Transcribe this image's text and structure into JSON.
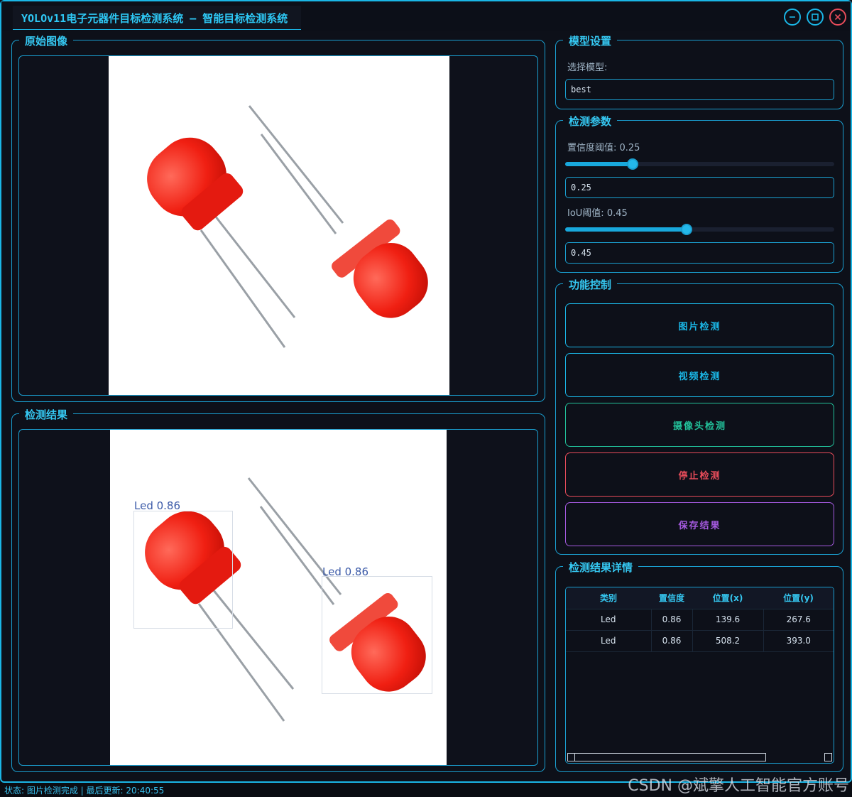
{
  "window": {
    "title": "YOLOv11电子元器件目标检测系统 – 智能目标检测系统",
    "controls": [
      "minimize-icon",
      "maximize-icon",
      "close-icon"
    ],
    "accent": "#1ab6e6"
  },
  "original": {
    "title": "原始图像"
  },
  "result": {
    "title": "检测结果",
    "detections": [
      {
        "label": "Led 0.86"
      },
      {
        "label": "Led 0.86"
      }
    ]
  },
  "model": {
    "title": "模型设置",
    "select_label": "选择模型:",
    "selected": "best"
  },
  "params": {
    "title": "检测参数",
    "conf_label": "置信度阈值: 0.25",
    "conf_value": "0.25",
    "conf_level": 0.25,
    "iou_label": "IoU阈值: 0.45",
    "iou_value": "0.45",
    "iou_level": 0.45
  },
  "functions": {
    "title": "功能控制",
    "image_detect": "图片检测",
    "video_detect": "视频检测",
    "camera_detect": "摄像头检测",
    "stop_detect": "停止检测",
    "save_result": "保存结果",
    "colors": {
      "image": "#1ab6e6",
      "camera": "#22c19a",
      "stop": "#e84c5a",
      "save": "#a55ae0"
    }
  },
  "details": {
    "title": "检测结果详情",
    "headers": [
      "类别",
      "置信度",
      "位置(x)",
      "位置(y)"
    ],
    "rows": [
      [
        "Led",
        "0.86",
        "139.6",
        "267.6"
      ],
      [
        "Led",
        "0.86",
        "508.2",
        "393.0"
      ]
    ]
  },
  "status": {
    "text": "状态: 图片检测完成 | 最后更新: 20:40:55"
  },
  "watermark": "CSDN @斌擎人工智能官方账号"
}
